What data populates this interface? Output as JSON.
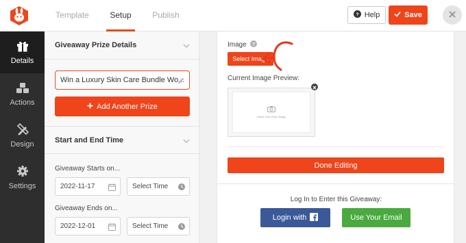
{
  "header": {
    "tabs": [
      {
        "label": "Template",
        "active": false
      },
      {
        "label": "Setup",
        "active": true
      },
      {
        "label": "Publish",
        "active": false
      }
    ],
    "help_label": "Help",
    "save_label": "Save",
    "accent_color": "#f0441a"
  },
  "sidebar": {
    "items": [
      {
        "label": "Details",
        "icon": "gift-icon",
        "active": true
      },
      {
        "label": "Actions",
        "icon": "cubes-icon",
        "active": false
      },
      {
        "label": "Design",
        "icon": "pencil-ruler-icon",
        "active": false
      },
      {
        "label": "Settings",
        "icon": "gear-icon",
        "active": false
      }
    ]
  },
  "panel": {
    "prize_section_title": "Giveaway Prize Details",
    "prize_name_value": "Win a Luxury Skin Care Bundle Wo...",
    "add_prize_label": "Add Another Prize",
    "time_section_title": "Start and End Time",
    "starts_label": "Giveaway Starts on...",
    "start_date": "2022-11-17",
    "start_time_placeholder": "Select Time",
    "ends_label": "Giveaway Ends on...",
    "end_date": "2022-12-01",
    "end_time_placeholder": "Select Time"
  },
  "main": {
    "image_label": "Image",
    "select_image_label": "Select Image",
    "preview_label": "Current Image Preview:",
    "preview_placeholder": "Insert Your Prize Image",
    "done_label": "Done Editing",
    "login_prompt": "Log In to Enter this Giveaway:",
    "facebook_login_label": "Login with",
    "email_label": "Use Your Email",
    "facebook_color": "#3b5998",
    "email_color": "#4aaa3f"
  }
}
